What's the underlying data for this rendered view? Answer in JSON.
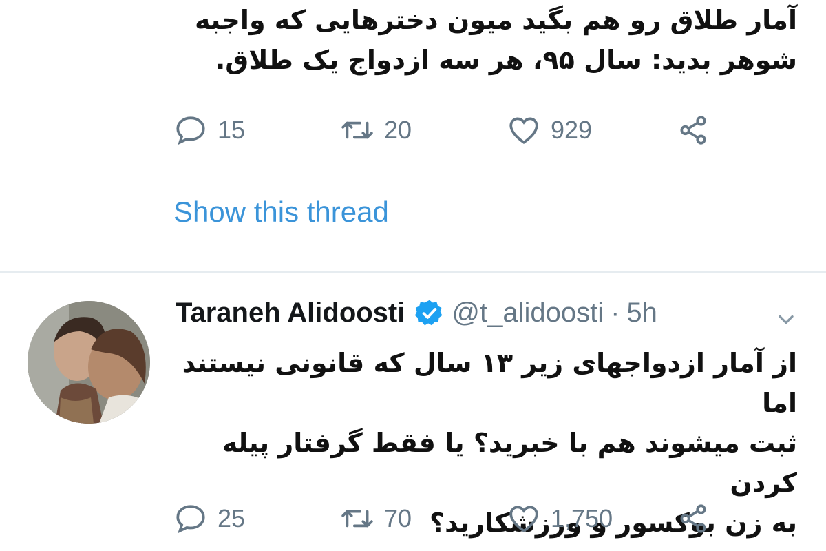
{
  "tweet1": {
    "text": "آمار طلاق رو هم بگید میون دخترهایی که واجبه\nشوهر بدید: سال ۹۵، هر سه ازدواج یک طلاق.",
    "replies": "15",
    "retweets": "20",
    "likes": "929",
    "show_thread": "Show this thread"
  },
  "tweet2": {
    "author_name": "Taraneh Alidoosti",
    "handle": "@t_alidoosti",
    "separator": "·",
    "time": "5h",
    "text": "از آمار ازدواجهای زیر ۱۳ سال که قانونی نیستند اما\nثبت میشوند هم با خبرید؟ یا فقط گرفتار پیله کردن\nبه زن بوکسور و ورزشکارید؟",
    "replies": "25",
    "retweets": "70",
    "likes": "1,750"
  },
  "colors": {
    "link": "#3b94d9",
    "muted": "#657786",
    "verified": "#1da1f2",
    "divider": "#e6ecf0"
  },
  "icons": [
    "reply-icon",
    "retweet-icon",
    "like-icon",
    "share-icon",
    "verified-icon",
    "chevron-down-icon"
  ]
}
